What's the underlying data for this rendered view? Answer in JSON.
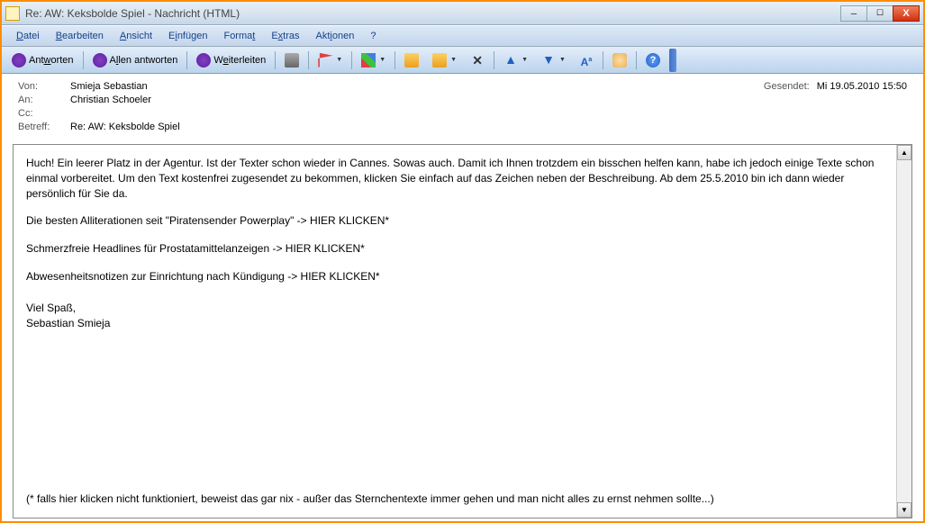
{
  "window": {
    "title": "Re: AW: Keksbolde Spiel - Nachricht (HTML)"
  },
  "menu": {
    "datei": "Datei",
    "bearbeiten": "Bearbeiten",
    "ansicht": "Ansicht",
    "einfuegen": "Einfügen",
    "format": "Format",
    "extras": "Extras",
    "aktionen": "Aktionen",
    "help": "?"
  },
  "toolbar": {
    "reply": "Antworten",
    "replyall": "Allen antworten",
    "forward": "Weiterleiten"
  },
  "header": {
    "from_label": "Von:",
    "from": "Smieja Sebastian",
    "to_label": "An:",
    "to": "Christian Schoeler",
    "cc_label": "Cc:",
    "cc": "",
    "subject_label": "Betreff:",
    "subject": "Re: AW: Keksbolde Spiel",
    "sent_label": "Gesendet:",
    "sent": "Mi 19.05.2010 15:50"
  },
  "body": {
    "p1": "Huch! Ein leerer Platz in der Agentur. Ist der Texter schon wieder in Cannes. Sowas auch. Damit ich Ihnen trotzdem ein bisschen helfen kann, habe ich jedoch einige Texte schon einmal vorbereitet. Um den Text kostenfrei zugesendet zu bekommen, klicken Sie einfach auf das Zeichen neben der Beschreibung. Ab dem 25.5.2010 bin ich dann wieder persönlich für Sie da.",
    "p2": "Die besten Alliterationen seit \"Piratensender Powerplay\" -> HIER KLICKEN*",
    "p3": "Schmerzfreie Headlines für Prostatamittelanzeigen -> HIER KLICKEN*",
    "p4": "Abwesenheitsnotizen zur Einrichtung nach Kündigung -> HIER KLICKEN*",
    "p5": "Viel Spaß,",
    "p6": "Sebastian Smieja",
    "footer": "(* falls hier klicken nicht funktioniert, beweist das gar nix - außer das Sternchentexte immer gehen und man nicht alles zu ernst nehmen sollte...)"
  }
}
